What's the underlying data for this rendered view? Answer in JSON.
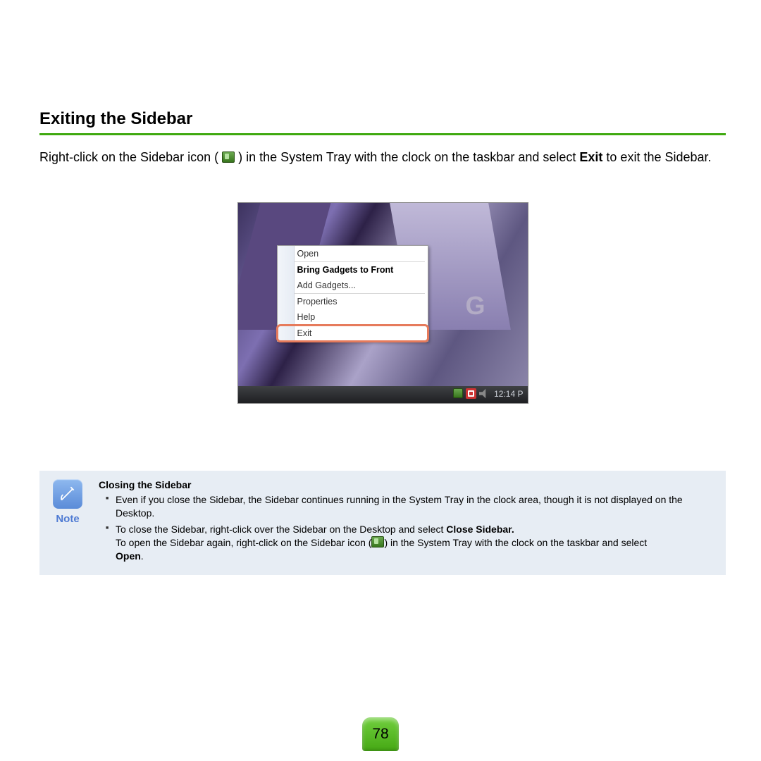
{
  "heading": "Exiting the Sidebar",
  "intro": {
    "part1": "Right-click on the Sidebar icon (",
    "part2": ") in the System Tray with the clock on the taskbar and select ",
    "bold": "Exit",
    "part3": " to exit the Sidebar."
  },
  "menu": {
    "letter": "G",
    "items": {
      "open": "Open",
      "bring": "Bring Gadgets to Front",
      "add": "Add Gadgets...",
      "props": "Properties",
      "help": "Help",
      "exit": "Exit"
    },
    "time": "12:14 P"
  },
  "note": {
    "label": "Note",
    "title": "Closing the Sidebar",
    "li1": "Even if you close the Sidebar, the Sidebar continues running in the System Tray in the clock area, though it is not displayed on the Desktop.",
    "li2a": "To close the Sidebar, right-click over the Sidebar on the Desktop and select ",
    "li2bold": "Close Sidebar.",
    "li3a": "To open the Sidebar again, right-click on the Sidebar icon (",
    "li3b": ") in the System Tray with the clock on the taskbar and select ",
    "li3bold": "Open",
    "li3c": "."
  },
  "page_number": "78"
}
